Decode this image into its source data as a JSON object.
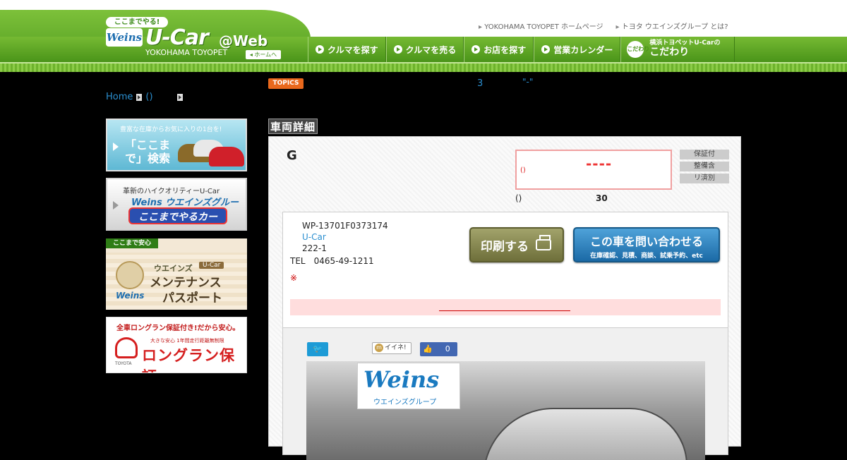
{
  "header": {
    "badge": "ここまでやる!",
    "logo_weins": "Weins",
    "logo_ucar": "U-Car",
    "logo_web": "@Web",
    "logo_company": "YOKOHAMA TOYOPET",
    "home_button": "◂ ホームへ",
    "top_links": [
      "YOKOHAMA TOYOPET ホームページ",
      "トヨタ ウエインズグループ とは?"
    ],
    "nav": [
      "クルマを探す",
      "クルマを売る",
      "お店を探す",
      "営業カレンダー"
    ],
    "nav_last_icon": "こだわり",
    "nav_last_small": "横浜トヨペットU-Carの",
    "nav_last_big": "こだわり"
  },
  "breadcrumb": {
    "home": "Home",
    "item1": "()"
  },
  "topics": {
    "badge": "TOPICS",
    "text1": "3",
    "text2": "\"-\""
  },
  "sidebar": {
    "search": {
      "top": "豊富な在庫からお気に入りの1台を!",
      "main": "「ここまで」検索"
    },
    "car": {
      "top": "革新のハイクオリティーU-Car",
      "logo": "Weins ウエインズグループ",
      "main": "ここまでやるカー"
    },
    "maint": {
      "tab": "ここまで安心",
      "l1": "ウエインズ",
      "ucar": "U-Car",
      "l2": "メンテナンス",
      "l3": "パスポート",
      "weins": "Weins"
    },
    "long": {
      "top": "全車ロングラン保証付き!だから安心。",
      "sub": "大きな安心 1年間走行距離無制限",
      "toyota": "TOYOTA",
      "main": "ロングラン保証"
    }
  },
  "detail": {
    "section_title": "車両詳細",
    "grade": "G",
    "price_label": "()",
    "price_value": "----",
    "tags": [
      "保証付",
      "整備含",
      "リ済別"
    ],
    "info_label": "()",
    "info_num": "30",
    "stock_no": "WP-13701F0373174",
    "shop_link": "U-Car",
    "address": "222-1",
    "tel": "TEL　0465-49-1211",
    "note_mark": "※",
    "print_label": "印刷する",
    "contact_main": "この車を問い合わせる",
    "contact_sub": "在庫確認、見積、商談、試乗予約、etc",
    "tw_label": "🐦",
    "iine_label": "イイネ!",
    "iine_icon": "m",
    "fb_like": "👍",
    "fb_count": "0",
    "photo_sign_logo": "Weins",
    "photo_sign_sub": "ウエインズグループ"
  }
}
